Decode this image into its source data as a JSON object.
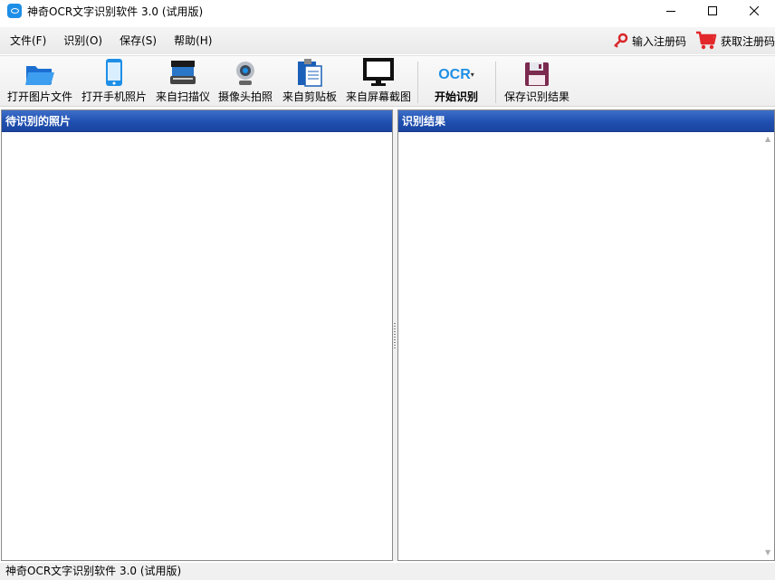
{
  "window": {
    "title": "神奇OCR文字识别软件 3.0 (试用版)"
  },
  "menu": {
    "items": [
      {
        "label": "文件(F)"
      },
      {
        "label": "识别(O)"
      },
      {
        "label": "保存(S)"
      },
      {
        "label": "帮助(H)"
      }
    ],
    "enter_code_label": "输入注册码",
    "get_code_label": "获取注册码"
  },
  "toolbar": {
    "open_file_label": "打开图片文件",
    "open_phone_label": "打开手机照片",
    "scanner_label": "来自扫描仪",
    "camera_label": "摄像头拍照",
    "clipboard_label": "来自剪贴板",
    "screen_label": "来自屏幕截图",
    "ocr_icon_text": "OCR",
    "start_ocr_label": "开始识别",
    "save_result_label": "保存识别结果"
  },
  "panels": {
    "left_title": "待识别的照片",
    "right_title": "识别结果"
  },
  "statusbar": {
    "text": "神奇OCR文字识别软件 3.0 (试用版)"
  },
  "colors": {
    "panel_header": "#2352b4",
    "accent_icon": "#1e8fe6",
    "cart_red": "#e2282b"
  }
}
